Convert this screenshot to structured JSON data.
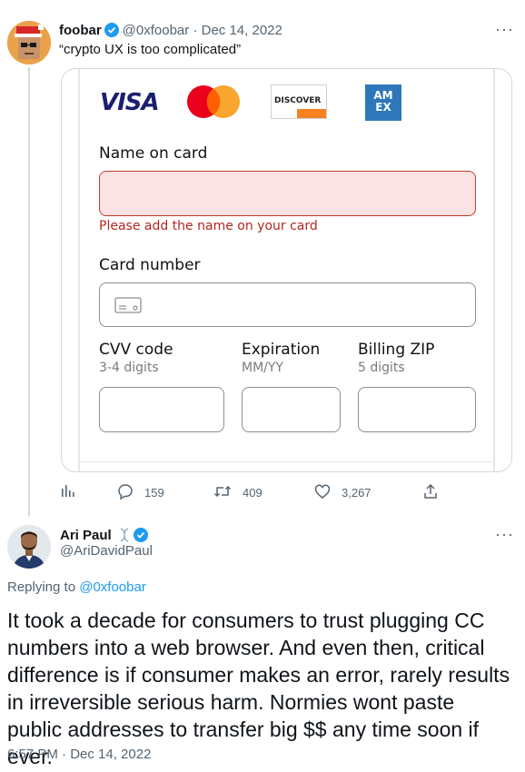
{
  "tweet1": {
    "name": "foobar",
    "handle": "@0xfoobar",
    "date": "· Dec 14, 2022",
    "text": "“crypto UX is too complicated”",
    "more": "···"
  },
  "card_form": {
    "brands": [
      "VISA",
      "DISCOVER",
      "AM EX"
    ],
    "name_label": "Name on card",
    "name_error": "Please add the name on your card",
    "number_label": "Card number",
    "cvv_label": "CVV code",
    "cvv_hint": "3-4 digits",
    "exp_label": "Expiration",
    "exp_hint": "MM/YY",
    "zip_label": "Billing ZIP",
    "zip_hint": "5 digits"
  },
  "actions": {
    "replies": "159",
    "retweets": "409",
    "likes": "3,267"
  },
  "tweet2": {
    "name": "Ari Paul",
    "handle": "@AriDavidPaul",
    "more": "···",
    "replying_prefix": "Replying to",
    "replying_handle": "@0xfoobar",
    "text": "It took a decade for consumers to trust plugging CC numbers into a web browser.  And even then, critical difference is if consumer makes an error, rarely results in irreversible serious harm.  Normies wont paste public addresses to transfer big $$ any time soon if ever.",
    "timestamp": "6:57 PM · Dec 14, 2022"
  },
  "colors": {
    "accent": "#1d9bf0",
    "error": "#b3261e",
    "muted": "#536471"
  }
}
